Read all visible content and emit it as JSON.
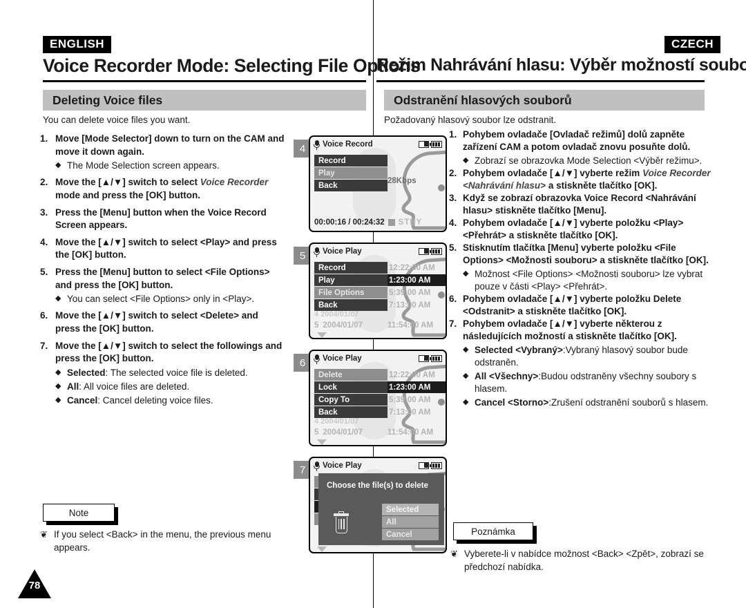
{
  "left": {
    "lang_tag": "ENGLISH",
    "title": "Voice Recorder Mode: Selecting File Options",
    "section": "Deleting Voice files",
    "intro": "You can delete voice files you want.",
    "steps": [
      {
        "num": "1.",
        "main": "Move [Mode Selector] down to turn on the CAM and move it down again.",
        "subs": [
          {
            "text": "The Mode Selection screen appears."
          }
        ]
      },
      {
        "num": "2.",
        "main_pre": "Move the [▲/▼] switch to select ",
        "main_ital": "Voice Recorder",
        "main_post": " mode and press the [OK] button.",
        "subs": []
      },
      {
        "num": "3.",
        "main": "Press the [Menu] button when the Voice Record Screen appears.",
        "subs": []
      },
      {
        "num": "4.",
        "main": "Move the [▲/▼] switch to select <Play> and press the [OK] button.",
        "subs": []
      },
      {
        "num": "5.",
        "main": "Press the [Menu] button to select <File Options> and press the [OK] button.",
        "subs": [
          {
            "text": "You can select <File Options> only in <Play>."
          }
        ]
      },
      {
        "num": "6.",
        "main": "Move the [▲/▼] switch to select <Delete> and press the [OK] button.",
        "subs": []
      },
      {
        "num": "7.",
        "main": "Move the [▲/▼] switch to select the followings and press the [OK] button.",
        "subs": [
          {
            "bold": "Selected",
            "text": ": The selected voice file is deleted."
          },
          {
            "bold": "All",
            "text": ": All voice files are deleted."
          },
          {
            "bold": "Cancel",
            "text": ": Cancel deleting voice files."
          }
        ]
      }
    ],
    "note_label": "Note",
    "note_marker": "❦",
    "note_text": "If you select <Back> in the menu, the previous menu appears."
  },
  "right": {
    "lang_tag": "CZECH",
    "title": "Režim Nahrávání hlasu: Výběr možností souborů",
    "section": "Odstranění hlasových souborů",
    "intro": "Požadovaný hlasový soubor lze odstranit.",
    "steps": [
      {
        "num": "1.",
        "main": "Pohybem ovladače [Ovladač režimů] dolů zapněte zařízení CAM a potom ovladač znovu posuňte dolů.",
        "subs": [
          {
            "text": "Zobrazí se obrazovka Mode Selection <Výběr režimu>."
          }
        ]
      },
      {
        "num": "2.",
        "main_pre": "Pohybem ovladače [▲/▼] vyberte režim ",
        "main_ital": "Voice Recorder <Nahrávání hlasu>",
        "main_post": " a stiskněte tlačítko [OK].",
        "subs": []
      },
      {
        "num": "3.",
        "main": "Když se zobrazí obrazovka Voice Record <Nahrávání hlasu> stiskněte tlačítko [Menu].",
        "subs": []
      },
      {
        "num": "4.",
        "main": "Pohybem ovladače [▲/▼] vyberte položku <Play> <Přehrát> a stiskněte tlačítko [OK].",
        "subs": []
      },
      {
        "num": "5.",
        "main": "Stisknutím tlačítka [Menu] vyberte položku <File Options> <Možnosti souboru> a stiskněte tlačítko [OK].",
        "subs": [
          {
            "text": "Možnost <File Options> <Možnosti souboru> lze vybrat pouze v části <Play> <Přehrát>."
          }
        ]
      },
      {
        "num": "6.",
        "main": "Pohybem ovladače [▲/▼] vyberte položku Delete <Odstranit> a stiskněte tlačítko [OK].",
        "subs": []
      },
      {
        "num": "7.",
        "main": "Pohybem ovladače [▲/▼] vyberte některou z následujících možností a stiskněte tlačítko [OK].",
        "subs": [
          {
            "bold": "Selected <Vybraný>",
            "text": ":Vybraný hlasový soubor bude odstraněn."
          },
          {
            "bold": "All <Všechny>",
            "text": ":Budou odstraněny všechny soubory s hlasem."
          },
          {
            "bold": "Cancel <Storno>",
            "text": ":Zrušení odstranění souborů s hlasem."
          }
        ]
      }
    ],
    "note_label": "Poznámka",
    "note_marker": "❦",
    "note_text": "Vyberete-li v nabídce možnost <Back> <Zpět>, zobrazí se předchozí nabídka."
  },
  "screens": [
    {
      "badge": "4",
      "title": "Voice Record",
      "icons": [
        "memory-card-icon",
        "battery-icon"
      ],
      "menu": [
        {
          "label": "Record",
          "state": "dark"
        },
        {
          "label": "Play",
          "state": "highlight"
        },
        {
          "label": "Back",
          "state": "dark"
        }
      ],
      "bitrate": "28Kbps",
      "status_time": "00:00:16 / 00:24:32",
      "status_mode": "STBY"
    },
    {
      "badge": "5",
      "title": "Voice Play",
      "icons": [
        "memory-card-icon",
        "battery-icon"
      ],
      "menu": [
        {
          "label": "Record",
          "state": "dark"
        },
        {
          "label": "Play",
          "state": "dark"
        },
        {
          "label": "File Options",
          "state": "highlight"
        },
        {
          "label": "Back",
          "state": "dark"
        }
      ],
      "files": [
        {
          "time": "12:22:00 AM",
          "selected": false
        },
        {
          "time": "1:23:00 AM",
          "selected": true
        },
        {
          "time": "5:39:00 AM",
          "selected": false
        },
        {
          "time": "7:13:00 AM",
          "selected": false
        }
      ],
      "ghost_row": "4  2004/01/07",
      "last_row": {
        "index": "5",
        "date": "2004/01/07",
        "time": "11:54:00 AM"
      }
    },
    {
      "badge": "6",
      "title": "Voice Play",
      "icons": [
        "memory-card-icon",
        "battery-icon"
      ],
      "menu": [
        {
          "label": "Delete",
          "state": "highlight"
        },
        {
          "label": "Lock",
          "state": "dark"
        },
        {
          "label": "Copy To",
          "state": "dark"
        },
        {
          "label": "Back",
          "state": "dark"
        }
      ],
      "files": [
        {
          "time": "12:22:00 AM",
          "selected": false
        },
        {
          "time": "1:23:00 AM",
          "selected": true
        },
        {
          "time": "5:39:00 AM",
          "selected": false
        },
        {
          "time": "7:13:00 AM",
          "selected": false
        }
      ],
      "ghost_row": "4  2004/01/07",
      "last_row": {
        "index": "5",
        "date": "2004/01/07",
        "time": "11:54:00 AM"
      }
    },
    {
      "badge": "7",
      "title": "Voice Play",
      "icons": [
        "memory-card-icon",
        "battery-icon"
      ],
      "dialog": {
        "title": "Choose the file(s) to delete",
        "icon": "trash-icon",
        "options": [
          {
            "label": "Selected",
            "state": "highlight"
          },
          {
            "label": "All",
            "state": "normal"
          },
          {
            "label": "Cancel",
            "state": "normal"
          }
        ]
      }
    }
  ],
  "page_number": "78",
  "colors": {
    "tag_bg": "#000000",
    "section_bar": "#c0c0c0",
    "badge_bg": "#8c8c8c",
    "lcd_bg": "#f2f2f2",
    "menu_dark": "#3a3a3a",
    "menu_highlight": "#8e8e8e",
    "file_selected": "#1c1c1c",
    "dialog_bg": "#5a5a5a"
  }
}
